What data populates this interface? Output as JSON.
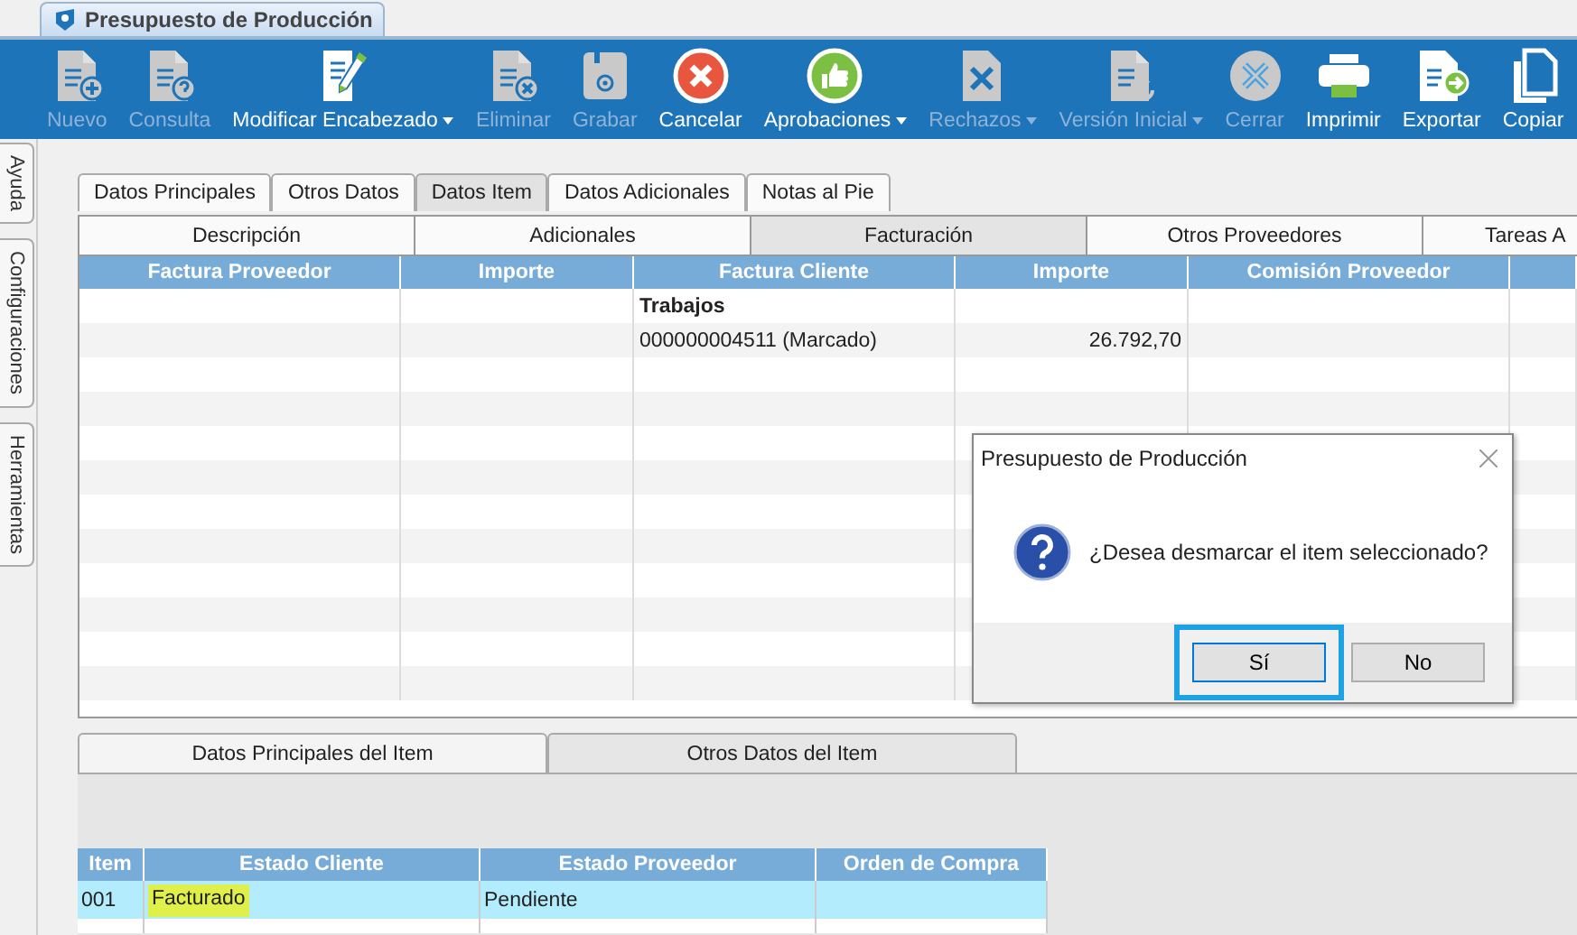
{
  "window": {
    "title": "Presupuesto de Producción"
  },
  "toolbar": [
    {
      "label": "Nuevo",
      "kind": "doc-plus",
      "disabled": true,
      "dropdown": false
    },
    {
      "label": "Consulta",
      "kind": "doc-question",
      "disabled": true,
      "dropdown": false
    },
    {
      "label": "Modificar Encabezado",
      "kind": "doc-pencil",
      "disabled": false,
      "dropdown": true
    },
    {
      "label": "Eliminar",
      "kind": "doc-x",
      "disabled": true,
      "dropdown": false
    },
    {
      "label": "Grabar",
      "kind": "floppy",
      "disabled": true,
      "dropdown": false
    },
    {
      "label": "Cancelar",
      "kind": "cancel",
      "disabled": false,
      "dropdown": false
    },
    {
      "label": "Aprobaciones",
      "kind": "thumb",
      "disabled": false,
      "dropdown": true
    },
    {
      "label": "Rechazos",
      "kind": "doc-cross",
      "disabled": true,
      "dropdown": true
    },
    {
      "label": "Versión Inicial",
      "kind": "doc-refresh",
      "disabled": true,
      "dropdown": true
    },
    {
      "label": "Cerrar",
      "kind": "x-circle",
      "disabled": true,
      "dropdown": false
    },
    {
      "label": "Imprimir",
      "kind": "printer",
      "disabled": false,
      "dropdown": false
    },
    {
      "label": "Exportar",
      "kind": "doc-arrow",
      "disabled": false,
      "dropdown": false
    },
    {
      "label": "Copiar",
      "kind": "copy",
      "disabled": false,
      "dropdown": false
    }
  ],
  "side_tabs": [
    "Ayuda",
    "Configuraciones",
    "Herramientas"
  ],
  "tabs": [
    {
      "label": "Datos Principales",
      "selected": false
    },
    {
      "label": "Otros Datos",
      "selected": false
    },
    {
      "label": "Datos Item",
      "selected": true
    },
    {
      "label": "Datos Adicionales",
      "selected": false
    },
    {
      "label": "Notas al Pie",
      "selected": false
    }
  ],
  "sub_tabs": [
    {
      "label": "Descripción",
      "selected": false
    },
    {
      "label": "Adicionales",
      "selected": false
    },
    {
      "label": "Facturación",
      "selected": true
    },
    {
      "label": "Otros Proveedores",
      "selected": false
    },
    {
      "label": "Tareas A",
      "selected": false
    }
  ],
  "grid": {
    "columns": [
      "Factura Proveedor",
      "Importe",
      "Factura Cliente",
      "Importe",
      "Comisión Proveedor"
    ],
    "rows": [
      {
        "kind": "group",
        "factura_cliente": "Trabajos"
      },
      {
        "kind": "item",
        "factura_cliente": "000000004511 (Marcado)",
        "importe": "26.792,70"
      }
    ]
  },
  "dialog": {
    "title": "Presupuesto de Producción",
    "message": "¿Desea desmarcar el item seleccionado?",
    "buttons": [
      {
        "label": "Sí",
        "selected": true
      },
      {
        "label": "No",
        "selected": false
      }
    ]
  },
  "bottom_tabs": [
    {
      "label": "Datos Principales del Item",
      "selected": false
    },
    {
      "label": "Otros Datos del Item",
      "selected": true
    }
  ],
  "bottom_grid": {
    "columns": [
      "Item",
      "Estado Cliente",
      "Estado Proveedor",
      "Orden de Compra"
    ],
    "rows": [
      {
        "selected": true,
        "cells": [
          {
            "text": "001",
            "highlighted": false
          },
          {
            "text": "Facturado",
            "highlighted": true
          },
          {
            "text": "Pendiente",
            "highlighted": false
          }
        ]
      }
    ]
  }
}
